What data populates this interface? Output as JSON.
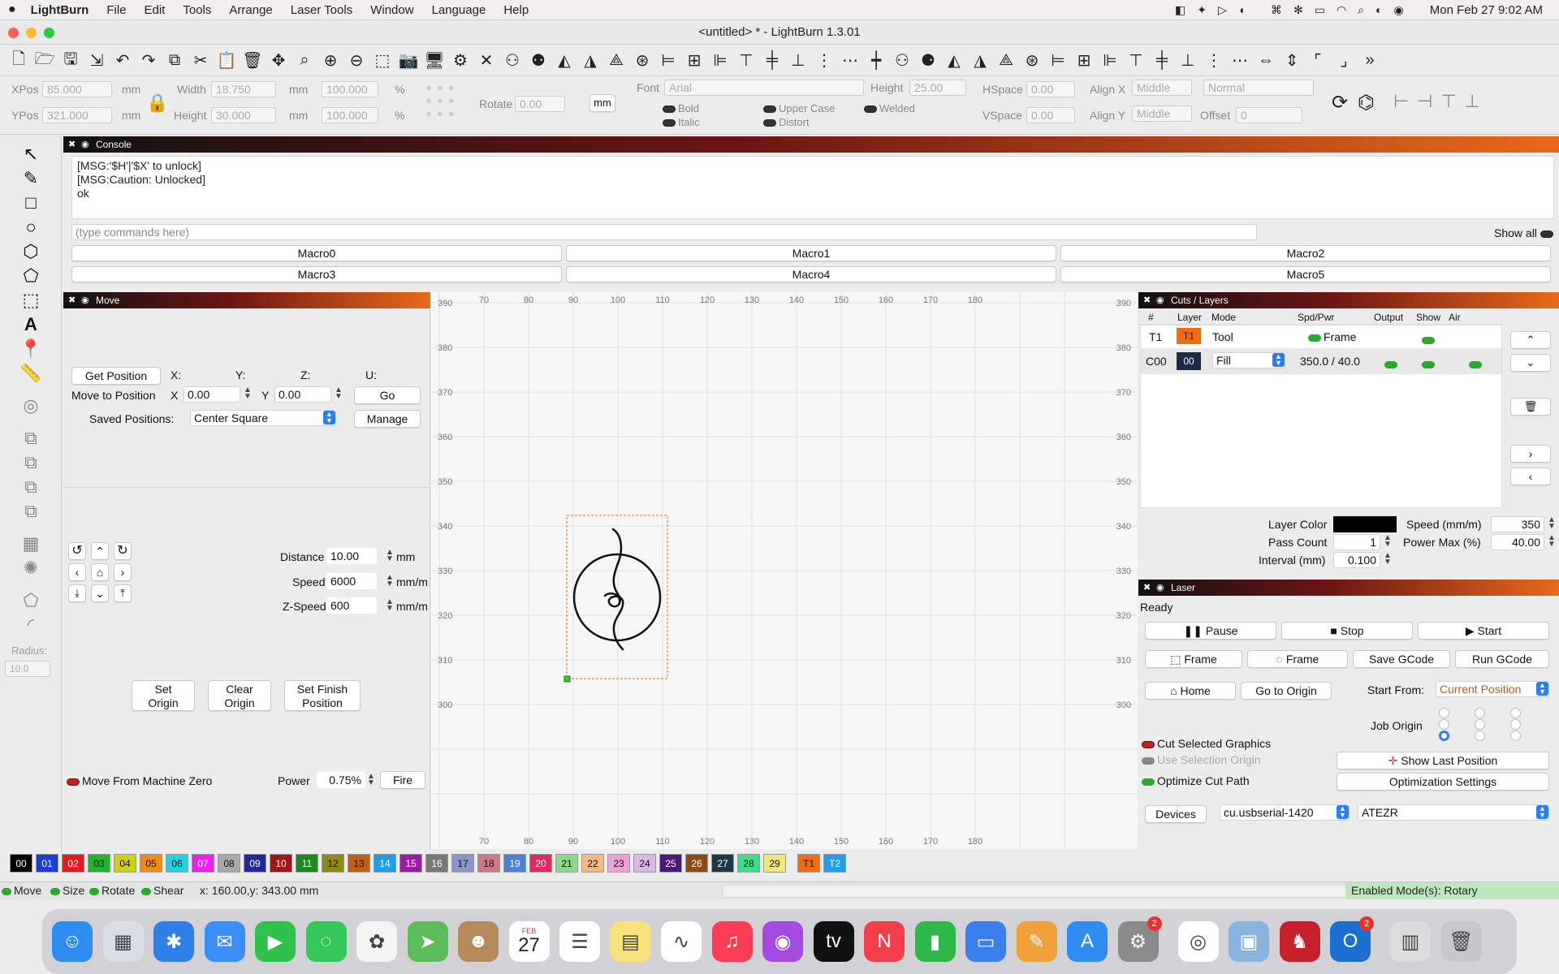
{
  "menubar": {
    "app_name": "LightBurn",
    "items": [
      "File",
      "Edit",
      "Tools",
      "Arrange",
      "Laser Tools",
      "Window",
      "Language",
      "Help"
    ],
    "clock": "Mon Feb 27  9:02 AM"
  },
  "window": {
    "title": "<untitled> * - LightBurn 1.3.01"
  },
  "props": {
    "xpos_label": "XPos",
    "xpos": "85.000",
    "ypos_label": "YPos",
    "ypos": "321.000",
    "unit": "mm",
    "width_label": "Width",
    "width": "18.750",
    "height_label": "Height",
    "height": "30.000",
    "pct1": "100.000",
    "pct2": "100.000",
    "pct_sign": "%",
    "rotate_label": "Rotate",
    "rotate": "0.00",
    "mm_button": "mm",
    "font_label": "Font",
    "font": "Arial",
    "font_height_label": "Height",
    "font_height": "25.00",
    "hspace_label": "HSpace",
    "hspace": "0.00",
    "vspace_label": "VSpace",
    "vspace": "0.00",
    "alignx_label": "Align X",
    "alignx": "Middle",
    "aligny_label": "Align Y",
    "aligny": "Middle",
    "normal": "Normal",
    "offset_label": "Offset",
    "offset": "0",
    "bold": "Bold",
    "italic": "Italic",
    "upper_case": "Upper Case",
    "distort": "Distort",
    "welded": "Welded"
  },
  "console": {
    "title": "Console",
    "log": "[MSG:'$H'|'$X' to unlock]\n[MSG:Caution: Unlocked]\nok",
    "placeholder": "(type commands here)",
    "show_all": "Show all",
    "macros": [
      "Macro0",
      "Macro1",
      "Macro2",
      "Macro3",
      "Macro4",
      "Macro5"
    ]
  },
  "move": {
    "title": "Move",
    "get_position": "Get Position",
    "x_col": "X:",
    "y_col": "Y:",
    "z_col": "Z:",
    "u_col": "U:",
    "move_to_position": "Move to Position",
    "x_label": "X",
    "x_val": "0.00",
    "y_label": "Y",
    "y_val": "0.00",
    "go": "Go",
    "saved_positions_label": "Saved Positions:",
    "saved_position": "Center Square",
    "manage": "Manage",
    "distance_label": "Distance",
    "distance": "10.00",
    "distance_unit": "mm",
    "speed_label": "Speed",
    "speed": "6000",
    "speed_unit": "mm/m",
    "zspeed_label": "Z-Speed",
    "zspeed": "600",
    "zspeed_unit": "mm/m",
    "set_origin": "Set\nOrigin",
    "clear_origin": "Clear\nOrigin",
    "set_finish": "Set Finish\nPosition",
    "move_from_zero": "Move From Machine Zero",
    "power_label": "Power",
    "power": "0.75%",
    "fire": "Fire"
  },
  "left_tools": {
    "radius_label": "Radius:",
    "radius": "10.0"
  },
  "canvas": {
    "x_ticks": [
      "70",
      "80",
      "90",
      "100",
      "110",
      "120",
      "130",
      "140",
      "150",
      "160",
      "170",
      "180"
    ],
    "y_ticks": [
      "390",
      "380",
      "370",
      "360",
      "350",
      "340",
      "330",
      "320",
      "310",
      "300"
    ]
  },
  "cuts": {
    "title": "Cuts / Layers",
    "headers": [
      "#",
      "Layer",
      "Mode",
      "Spd/Pwr",
      "Output",
      "Show",
      "Air"
    ],
    "rows": [
      {
        "num": "T1",
        "layer": "T1",
        "mode": "Tool",
        "spdpwr": "Frame",
        "layer_color": "#f26b0f"
      },
      {
        "num": "C00",
        "layer": "00",
        "mode": "Fill",
        "spdpwr": "350.0 / 40.0",
        "layer_color": "#1c2b44"
      }
    ],
    "layer_color_label": "Layer Color",
    "speed_label": "Speed (mm/m)",
    "speed": "350",
    "pass_count_label": "Pass Count",
    "pass_count": "1",
    "power_max_label": "Power Max (%)",
    "power_max": "40.00",
    "interval_label": "Interval (mm)",
    "interval": "0.100"
  },
  "laser": {
    "title": "Laser",
    "status": "Ready",
    "pause": "Pause",
    "stop": "Stop",
    "start": "Start",
    "frame1": "Frame",
    "frame2": "Frame",
    "save_gcode": "Save GCode",
    "run_gcode": "Run GCode",
    "home": "Home",
    "go_to_origin": "Go to Origin",
    "start_from_label": "Start From:",
    "start_from": "Current Position",
    "job_origin_label": "Job Origin",
    "cut_selected": "Cut Selected Graphics",
    "use_selection_origin": "Use Selection Origin",
    "optimize_cut_path": "Optimize Cut Path",
    "show_last_position": "Show Last Position",
    "optimization_settings": "Optimization Settings",
    "devices": "Devices",
    "port": "cu.usbserial-1420",
    "device": "ATEZR"
  },
  "palette": [
    {
      "label": "00",
      "color": "#000000",
      "text": "#ffffff"
    },
    {
      "label": "01",
      "color": "#1a3fd6",
      "text": "#ffffff"
    },
    {
      "label": "02",
      "color": "#e8191e",
      "text": "#ffffff"
    },
    {
      "label": "03",
      "color": "#1fb62d",
      "text": "#111111"
    },
    {
      "label": "04",
      "color": "#d2cf1a",
      "text": "#111111"
    },
    {
      "label": "05",
      "color": "#f08a14",
      "text": "#111111"
    },
    {
      "label": "06",
      "color": "#1fd4e0",
      "text": "#111111"
    },
    {
      "label": "07",
      "color": "#f01ef0",
      "text": "#ffffff"
    },
    {
      "label": "08",
      "color": "#a8a8a8",
      "text": "#111111"
    },
    {
      "label": "09",
      "color": "#1e2a9c",
      "text": "#ffffff"
    },
    {
      "label": "10",
      "color": "#a0141a",
      "text": "#ffffff"
    },
    {
      "label": "11",
      "color": "#1e8a1e",
      "text": "#ffffff"
    },
    {
      "label": "12",
      "color": "#8e8a14",
      "text": "#111111"
    },
    {
      "label": "13",
      "color": "#c06010",
      "text": "#111111"
    },
    {
      "label": "14",
      "color": "#1e9ef0",
      "text": "#ffffff"
    },
    {
      "label": "15",
      "color": "#9c1aa6",
      "text": "#ffffff"
    },
    {
      "label": "16",
      "color": "#787878",
      "text": "#ffffff"
    },
    {
      "label": "17",
      "color": "#8a96c8",
      "text": "#111111"
    },
    {
      "label": "18",
      "color": "#d07888",
      "text": "#111111"
    },
    {
      "label": "19",
      "color": "#4a80d8",
      "text": "#ffffff"
    },
    {
      "label": "20",
      "color": "#e02a60",
      "text": "#ffffff"
    },
    {
      "label": "21",
      "color": "#8ad88a",
      "text": "#111111"
    },
    {
      "label": "22",
      "color": "#f4b880",
      "text": "#111111"
    },
    {
      "label": "23",
      "color": "#f0a0d8",
      "text": "#111111"
    },
    {
      "label": "24",
      "color": "#d8b8e8",
      "text": "#111111"
    },
    {
      "label": "25",
      "color": "#4a1a7a",
      "text": "#ffffff"
    },
    {
      "label": "26",
      "color": "#8a4a1a",
      "text": "#ffffff"
    },
    {
      "label": "27",
      "color": "#1a3a4a",
      "text": "#ffffff"
    },
    {
      "label": "28",
      "color": "#3ae08a",
      "text": "#111111"
    },
    {
      "label": "29",
      "color": "#f0e878",
      "text": "#111111"
    },
    {
      "label": "T1",
      "color": "#f26b0f",
      "text": "#111111"
    },
    {
      "label": "T2",
      "color": "#1e9ef0",
      "text": "#ffffff"
    }
  ],
  "status": {
    "move": "Move",
    "size": "Size",
    "rotate": "Rotate",
    "shear": "Shear",
    "coords": "x: 160.00,y: 343.00 mm",
    "modes": "Enabled Mode(s): Rotary"
  },
  "dock": {
    "apps": [
      {
        "name": "finder-icon",
        "color": "#2d8cf0",
        "glyph": "☺"
      },
      {
        "name": "launchpad-icon",
        "color": "#d9dde6",
        "glyph": "▦"
      },
      {
        "name": "safari-icon",
        "color": "#2f7fe8",
        "glyph": "✱"
      },
      {
        "name": "mail-icon",
        "color": "#3a8ef6",
        "glyph": "✉"
      },
      {
        "name": "facetime-icon",
        "color": "#2fc24a",
        "glyph": "▶"
      },
      {
        "name": "messages-icon",
        "color": "#34c759",
        "glyph": "◌"
      },
      {
        "name": "photos-icon",
        "color": "#f4f4f4",
        "glyph": "✿"
      },
      {
        "name": "maps-icon",
        "color": "#5bbd5b",
        "glyph": "➤"
      },
      {
        "name": "contacts-icon",
        "color": "#b58a5c",
        "glyph": "☻"
      },
      {
        "name": "calendar-icon",
        "color": "#ffffff",
        "glyph": "27"
      },
      {
        "name": "reminders-icon",
        "color": "#ffffff",
        "glyph": "☰"
      },
      {
        "name": "notes-icon",
        "color": "#f8e27a",
        "glyph": "▤"
      },
      {
        "name": "freeform-icon",
        "color": "#ffffff",
        "glyph": "∿"
      },
      {
        "name": "music-icon",
        "color": "#fa3c55",
        "glyph": "♫"
      },
      {
        "name": "podcasts-icon",
        "color": "#a44ae0",
        "glyph": "◉"
      },
      {
        "name": "tv-icon",
        "color": "#111111",
        "glyph": "tv"
      },
      {
        "name": "news-icon",
        "color": "#f33d4a",
        "glyph": "N"
      },
      {
        "name": "numbers-icon",
        "color": "#2fb84a",
        "glyph": "▮"
      },
      {
        "name": "keynote-icon",
        "color": "#3a7ef0",
        "glyph": "▭"
      },
      {
        "name": "pages-icon",
        "color": "#f2a03a",
        "glyph": "✎"
      },
      {
        "name": "app-store-icon",
        "color": "#2f8cf0",
        "glyph": "A"
      },
      {
        "name": "system-settings-icon",
        "color": "#8a8a8a",
        "glyph": "⚙"
      },
      {
        "name": "chrome-icon",
        "color": "#ffffff",
        "glyph": "◎"
      },
      {
        "name": "preview-icon",
        "color": "#8ab4e0",
        "glyph": "▣"
      },
      {
        "name": "lightburn-icon",
        "color": "#c8202a",
        "glyph": "♞"
      },
      {
        "name": "outlook-icon",
        "color": "#1a6fd0",
        "glyph": "O"
      },
      {
        "name": "downloads-icon",
        "color": "#dcdcdc",
        "glyph": "▥"
      },
      {
        "name": "trash-icon",
        "color": "#c8c8cc",
        "glyph": "🗑"
      }
    ],
    "calendar_month": "FEB",
    "settings_badge": "2",
    "outlook_badge": "2"
  },
  "colors": {
    "accent": "#2a7ef0",
    "toggle_on": "#2aa830",
    "selection": "#f07a1a"
  }
}
